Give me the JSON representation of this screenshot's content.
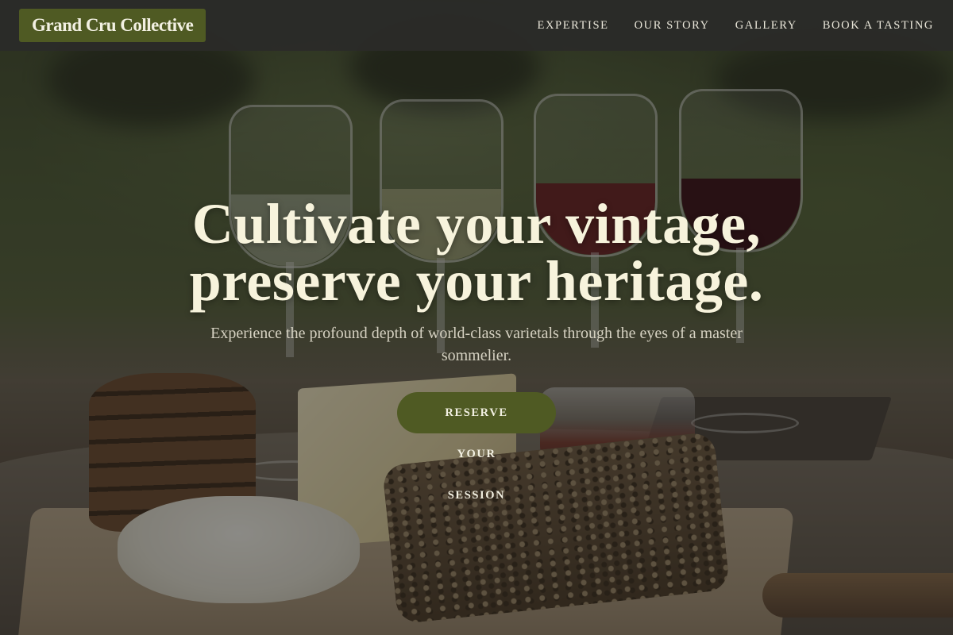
{
  "header": {
    "logo": "Grand Cru Collective",
    "nav": [
      {
        "label": "EXPERTISE"
      },
      {
        "label": "OUR STORY"
      },
      {
        "label": "GALLERY"
      },
      {
        "label": "BOOK A TASTING"
      }
    ]
  },
  "hero": {
    "title_line1": "Cultivate your vintage,",
    "title_line2": "preserve your heritage.",
    "subtitle": "Experience the profound depth of world-class varietals through the eyes of a master sommelier.",
    "cta_label": "RESERVE YOUR SESSION",
    "background_image": "wine-tasting-flight-with-cheese-board"
  },
  "colors": {
    "header_bg": "#2a2a28",
    "brand_olive": "#4f5a23",
    "title_text": "#f7f3dc",
    "nav_text": "#ece9dc",
    "subtitle_text": "#d6d2c2"
  }
}
